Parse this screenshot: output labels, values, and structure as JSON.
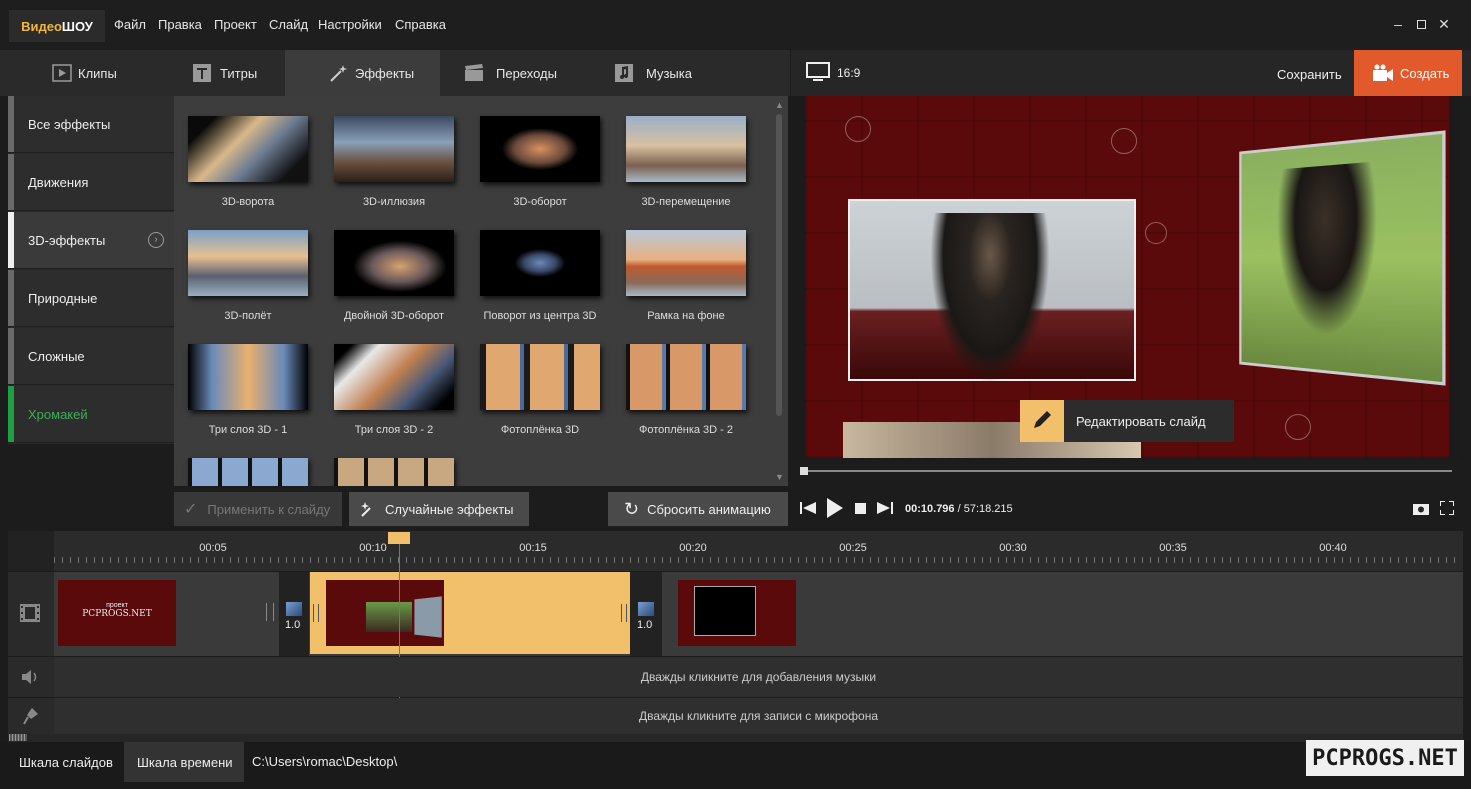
{
  "app": {
    "logo_part1": "Видео",
    "logo_part2": "ШОУ"
  },
  "menu": [
    "Файл",
    "Правка",
    "Проект",
    "Слайд",
    "Настройки",
    "Справка"
  ],
  "tabs": [
    {
      "label": "Клипы",
      "icon": "play-box-icon"
    },
    {
      "label": "Титры",
      "icon": "text-t-icon"
    },
    {
      "label": "Эффекты",
      "icon": "magic-wand-icon"
    },
    {
      "label": "Переходы",
      "icon": "clapper-icon"
    },
    {
      "label": "Музыка",
      "icon": "music-note-icon"
    }
  ],
  "categories": [
    "Все эффекты",
    "Движения",
    "3D-эффекты",
    "Природные",
    "Сложные",
    "Хромакей"
  ],
  "effects": [
    "3D-ворота",
    "3D-иллюзия",
    "3D-оборот",
    "3D-перемещение",
    "3D-полёт",
    "Двойной 3D-оборот",
    "Поворот из центра 3D",
    "Рамка на фоне",
    "Три слоя 3D - 1",
    "Три слоя 3D - 2",
    "Фотоплёнка 3D",
    "Фотоплёнка 3D - 2"
  ],
  "buttons": {
    "apply": "Применить к слайду",
    "random": "Случайные эффекты",
    "reset": "Сбросить анимацию"
  },
  "preview": {
    "aspect": "16:9",
    "save": "Сохранить",
    "create": "Создать",
    "edit_slide": "Редактировать слайд",
    "time_current": "00:10.796",
    "time_sep": " / ",
    "time_total": "57:18.215"
  },
  "timeline": {
    "ruler_labels": [
      "00:05",
      "00:10",
      "00:15",
      "00:20",
      "00:25",
      "00:30",
      "00:35",
      "00:40"
    ],
    "transition_durations": [
      "1.0",
      "1.0"
    ],
    "clip1_text_small": "проект",
    "clip1_text": "PCPROGS.NET",
    "music_hint": "Дважды кликните для добавления музыки",
    "mic_hint": "Дважды кликните для записи с микрофона"
  },
  "status": {
    "tab_slides": "Шкала слайдов",
    "tab_time": "Шкала времени",
    "path": "C:\\Users\\romac\\Desktop\\",
    "watermark": "PCPROGS.NET"
  },
  "colors": {
    "accent": "#e25a2b",
    "selection": "#f2c06b",
    "green": "#1f9e43"
  }
}
